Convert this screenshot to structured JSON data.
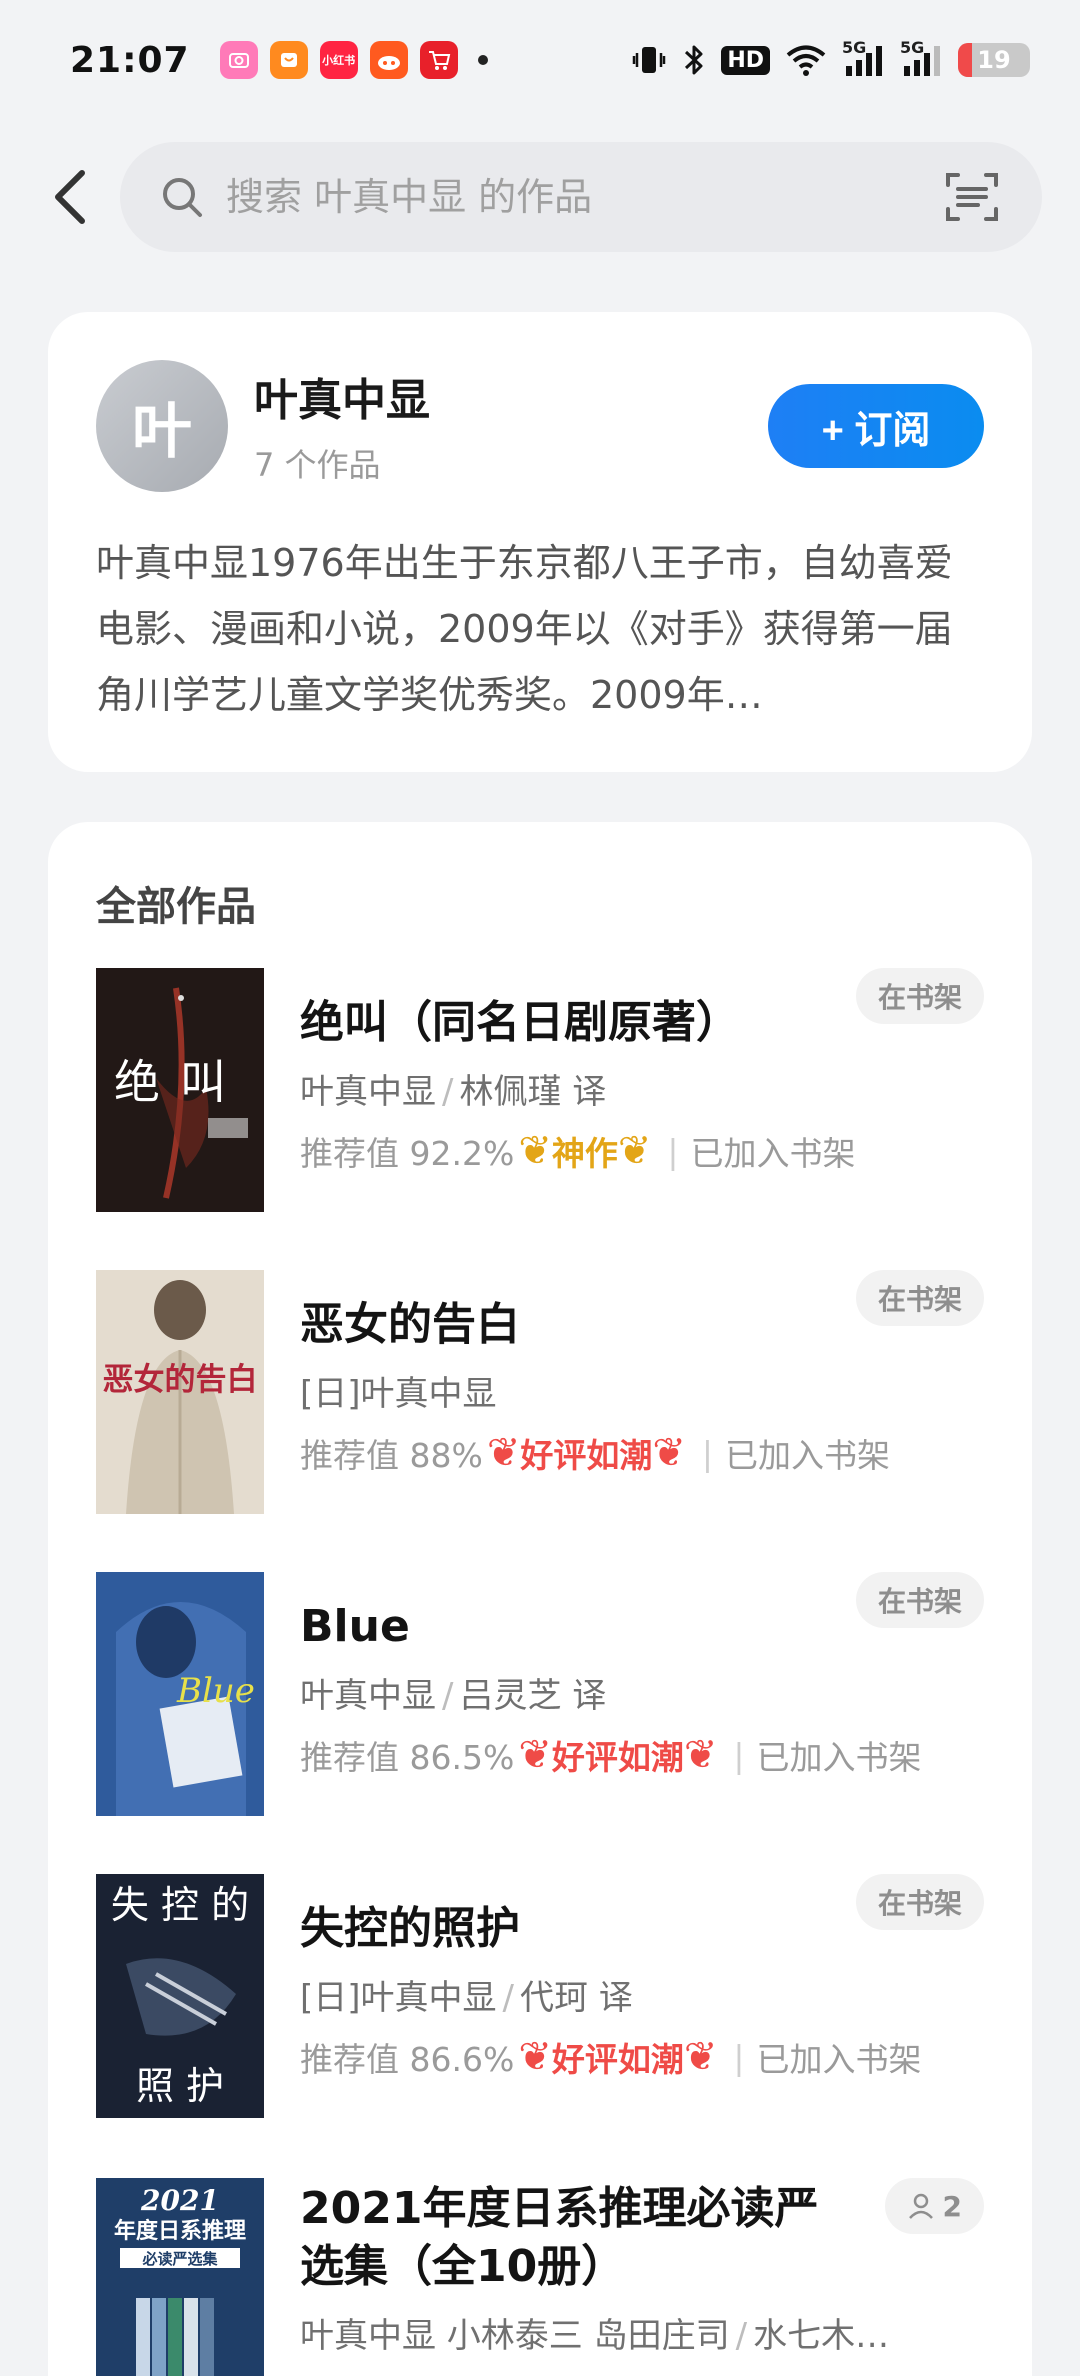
{
  "status_bar": {
    "time": "21:07",
    "notif_xhs": "小红书",
    "battery": "19",
    "battery_level": 0.19,
    "network_5g_a": "5G",
    "network_5g_b": "5G",
    "hd": "HD"
  },
  "search": {
    "placeholder": "搜索 叶真中显 的作品"
  },
  "author": {
    "avatar_char": "叶",
    "name": "叶真中显",
    "works_count": "7 个作品",
    "subscribe_label": "+ 订阅",
    "bio": "叶真中显1976年出生于东京都八王子市，自幼喜爱电影、漫画和小说，2009年以《对手》获得第一届角川学艺儿童文学奖优秀奖。2009年…"
  },
  "works": {
    "section_title": "全部作品",
    "books": [
      {
        "title": "绝叫（同名日剧原著）",
        "author": "叶真中显",
        "translator": "林佩瑾 译",
        "recommend": "推荐值 92.2%",
        "badge": "神作",
        "badge_color": "#e3a517",
        "shelf_status": "已加入书架",
        "tag": "在书架",
        "cover_text": "绝叫"
      },
      {
        "title": "恶女的告白",
        "author": "[日]叶真中显",
        "translator": "",
        "recommend": "推荐值 88%",
        "badge": "好评如潮",
        "badge_color": "#ef4b47",
        "shelf_status": "已加入书架",
        "tag": "在书架",
        "cover_text": "恶女的告白"
      },
      {
        "title": "Blue",
        "author": "叶真中显",
        "translator": "吕灵芝 译",
        "recommend": "推荐值 86.5%",
        "badge": "好评如潮",
        "badge_color": "#ef4b47",
        "shelf_status": "已加入书架",
        "tag": "在书架",
        "cover_text": "Blue"
      },
      {
        "title": "失控的照护",
        "author": "[日]叶真中显",
        "translator": "代珂 译",
        "recommend": "推荐值 86.6%",
        "badge": "好评如潮",
        "badge_color": "#ef4b47",
        "shelf_status": "已加入书架",
        "tag": "在书架",
        "cover_text_top": "失 控 的",
        "cover_text_bottom": "照  护"
      },
      {
        "title": "2021年度日系推理必读严选集（全10册）",
        "author": "叶真中显 小林泰三 岛田庄司",
        "translator": "水七木…",
        "readers": "2",
        "cover_year": "2021",
        "cover_title": "年度日系推理",
        "cover_sub": "必读严选集"
      }
    ]
  }
}
